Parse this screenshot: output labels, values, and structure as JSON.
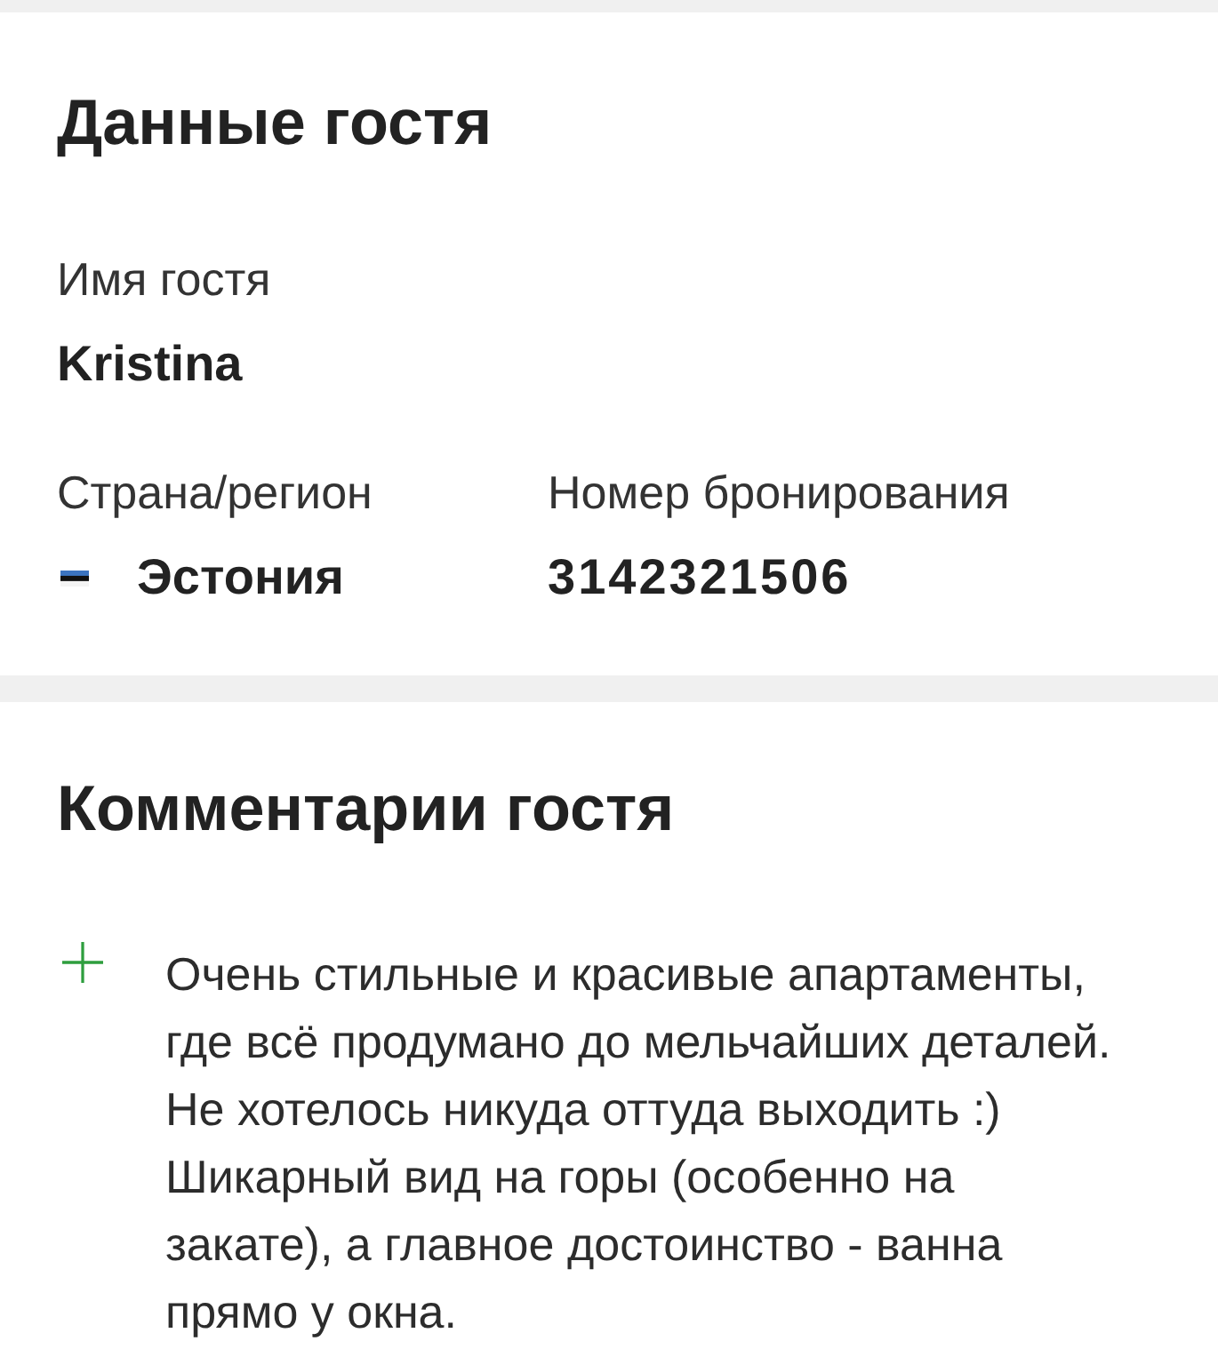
{
  "guest_details": {
    "title": "Данные гостя",
    "guest_name": {
      "label": "Имя гостя",
      "value": "Kristina"
    },
    "country": {
      "label": "Страна/регион",
      "value": "Эстония"
    },
    "booking_number": {
      "label": "Номер бронирования",
      "value": "3142321506"
    }
  },
  "guest_comments": {
    "title": "Комментарии гостя",
    "comments": [
      {
        "kind": "positive",
        "text": "Очень стильные и красивые апартаменты, где всё продумано до мельчайших деталей. Не хотелось никуда оттуда выходить :) Шикарный вид на горы (особенно на закате), а главное достоинство - ванна прямо у окна."
      }
    ]
  }
}
